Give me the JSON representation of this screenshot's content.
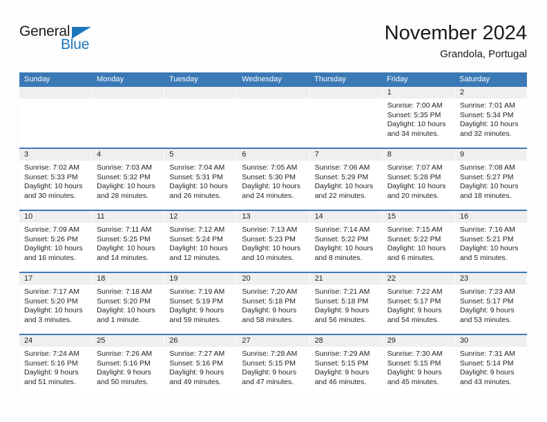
{
  "brand": {
    "name_part1": "General",
    "name_part2": "Blue",
    "accent_color": "#1b75bb",
    "triangle_icon": "blue-triangle-icon"
  },
  "header": {
    "title": "November 2024",
    "location": "Grandola, Portugal"
  },
  "calendar": {
    "header_bg": "#3b79b6",
    "daynum_bg": "#efefef",
    "weekday_headers": [
      "Sunday",
      "Monday",
      "Tuesday",
      "Wednesday",
      "Thursday",
      "Friday",
      "Saturday"
    ],
    "weeks": [
      [
        {
          "day": "",
          "sunrise": "",
          "sunset": "",
          "daylight": ""
        },
        {
          "day": "",
          "sunrise": "",
          "sunset": "",
          "daylight": ""
        },
        {
          "day": "",
          "sunrise": "",
          "sunset": "",
          "daylight": ""
        },
        {
          "day": "",
          "sunrise": "",
          "sunset": "",
          "daylight": ""
        },
        {
          "day": "",
          "sunrise": "",
          "sunset": "",
          "daylight": ""
        },
        {
          "day": "1",
          "sunrise": "Sunrise: 7:00 AM",
          "sunset": "Sunset: 5:35 PM",
          "daylight": "Daylight: 10 hours and 34 minutes."
        },
        {
          "day": "2",
          "sunrise": "Sunrise: 7:01 AM",
          "sunset": "Sunset: 5:34 PM",
          "daylight": "Daylight: 10 hours and 32 minutes."
        }
      ],
      [
        {
          "day": "3",
          "sunrise": "Sunrise: 7:02 AM",
          "sunset": "Sunset: 5:33 PM",
          "daylight": "Daylight: 10 hours and 30 minutes."
        },
        {
          "day": "4",
          "sunrise": "Sunrise: 7:03 AM",
          "sunset": "Sunset: 5:32 PM",
          "daylight": "Daylight: 10 hours and 28 minutes."
        },
        {
          "day": "5",
          "sunrise": "Sunrise: 7:04 AM",
          "sunset": "Sunset: 5:31 PM",
          "daylight": "Daylight: 10 hours and 26 minutes."
        },
        {
          "day": "6",
          "sunrise": "Sunrise: 7:05 AM",
          "sunset": "Sunset: 5:30 PM",
          "daylight": "Daylight: 10 hours and 24 minutes."
        },
        {
          "day": "7",
          "sunrise": "Sunrise: 7:06 AM",
          "sunset": "Sunset: 5:29 PM",
          "daylight": "Daylight: 10 hours and 22 minutes."
        },
        {
          "day": "8",
          "sunrise": "Sunrise: 7:07 AM",
          "sunset": "Sunset: 5:28 PM",
          "daylight": "Daylight: 10 hours and 20 minutes."
        },
        {
          "day": "9",
          "sunrise": "Sunrise: 7:08 AM",
          "sunset": "Sunset: 5:27 PM",
          "daylight": "Daylight: 10 hours and 18 minutes."
        }
      ],
      [
        {
          "day": "10",
          "sunrise": "Sunrise: 7:09 AM",
          "sunset": "Sunset: 5:26 PM",
          "daylight": "Daylight: 10 hours and 16 minutes."
        },
        {
          "day": "11",
          "sunrise": "Sunrise: 7:11 AM",
          "sunset": "Sunset: 5:25 PM",
          "daylight": "Daylight: 10 hours and 14 minutes."
        },
        {
          "day": "12",
          "sunrise": "Sunrise: 7:12 AM",
          "sunset": "Sunset: 5:24 PM",
          "daylight": "Daylight: 10 hours and 12 minutes."
        },
        {
          "day": "13",
          "sunrise": "Sunrise: 7:13 AM",
          "sunset": "Sunset: 5:23 PM",
          "daylight": "Daylight: 10 hours and 10 minutes."
        },
        {
          "day": "14",
          "sunrise": "Sunrise: 7:14 AM",
          "sunset": "Sunset: 5:22 PM",
          "daylight": "Daylight: 10 hours and 8 minutes."
        },
        {
          "day": "15",
          "sunrise": "Sunrise: 7:15 AM",
          "sunset": "Sunset: 5:22 PM",
          "daylight": "Daylight: 10 hours and 6 minutes."
        },
        {
          "day": "16",
          "sunrise": "Sunrise: 7:16 AM",
          "sunset": "Sunset: 5:21 PM",
          "daylight": "Daylight: 10 hours and 5 minutes."
        }
      ],
      [
        {
          "day": "17",
          "sunrise": "Sunrise: 7:17 AM",
          "sunset": "Sunset: 5:20 PM",
          "daylight": "Daylight: 10 hours and 3 minutes."
        },
        {
          "day": "18",
          "sunrise": "Sunrise: 7:18 AM",
          "sunset": "Sunset: 5:20 PM",
          "daylight": "Daylight: 10 hours and 1 minute."
        },
        {
          "day": "19",
          "sunrise": "Sunrise: 7:19 AM",
          "sunset": "Sunset: 5:19 PM",
          "daylight": "Daylight: 9 hours and 59 minutes."
        },
        {
          "day": "20",
          "sunrise": "Sunrise: 7:20 AM",
          "sunset": "Sunset: 5:18 PM",
          "daylight": "Daylight: 9 hours and 58 minutes."
        },
        {
          "day": "21",
          "sunrise": "Sunrise: 7:21 AM",
          "sunset": "Sunset: 5:18 PM",
          "daylight": "Daylight: 9 hours and 56 minutes."
        },
        {
          "day": "22",
          "sunrise": "Sunrise: 7:22 AM",
          "sunset": "Sunset: 5:17 PM",
          "daylight": "Daylight: 9 hours and 54 minutes."
        },
        {
          "day": "23",
          "sunrise": "Sunrise: 7:23 AM",
          "sunset": "Sunset: 5:17 PM",
          "daylight": "Daylight: 9 hours and 53 minutes."
        }
      ],
      [
        {
          "day": "24",
          "sunrise": "Sunrise: 7:24 AM",
          "sunset": "Sunset: 5:16 PM",
          "daylight": "Daylight: 9 hours and 51 minutes."
        },
        {
          "day": "25",
          "sunrise": "Sunrise: 7:26 AM",
          "sunset": "Sunset: 5:16 PM",
          "daylight": "Daylight: 9 hours and 50 minutes."
        },
        {
          "day": "26",
          "sunrise": "Sunrise: 7:27 AM",
          "sunset": "Sunset: 5:16 PM",
          "daylight": "Daylight: 9 hours and 49 minutes."
        },
        {
          "day": "27",
          "sunrise": "Sunrise: 7:28 AM",
          "sunset": "Sunset: 5:15 PM",
          "daylight": "Daylight: 9 hours and 47 minutes."
        },
        {
          "day": "28",
          "sunrise": "Sunrise: 7:29 AM",
          "sunset": "Sunset: 5:15 PM",
          "daylight": "Daylight: 9 hours and 46 minutes."
        },
        {
          "day": "29",
          "sunrise": "Sunrise: 7:30 AM",
          "sunset": "Sunset: 5:15 PM",
          "daylight": "Daylight: 9 hours and 45 minutes."
        },
        {
          "day": "30",
          "sunrise": "Sunrise: 7:31 AM",
          "sunset": "Sunset: 5:14 PM",
          "daylight": "Daylight: 9 hours and 43 minutes."
        }
      ]
    ]
  }
}
